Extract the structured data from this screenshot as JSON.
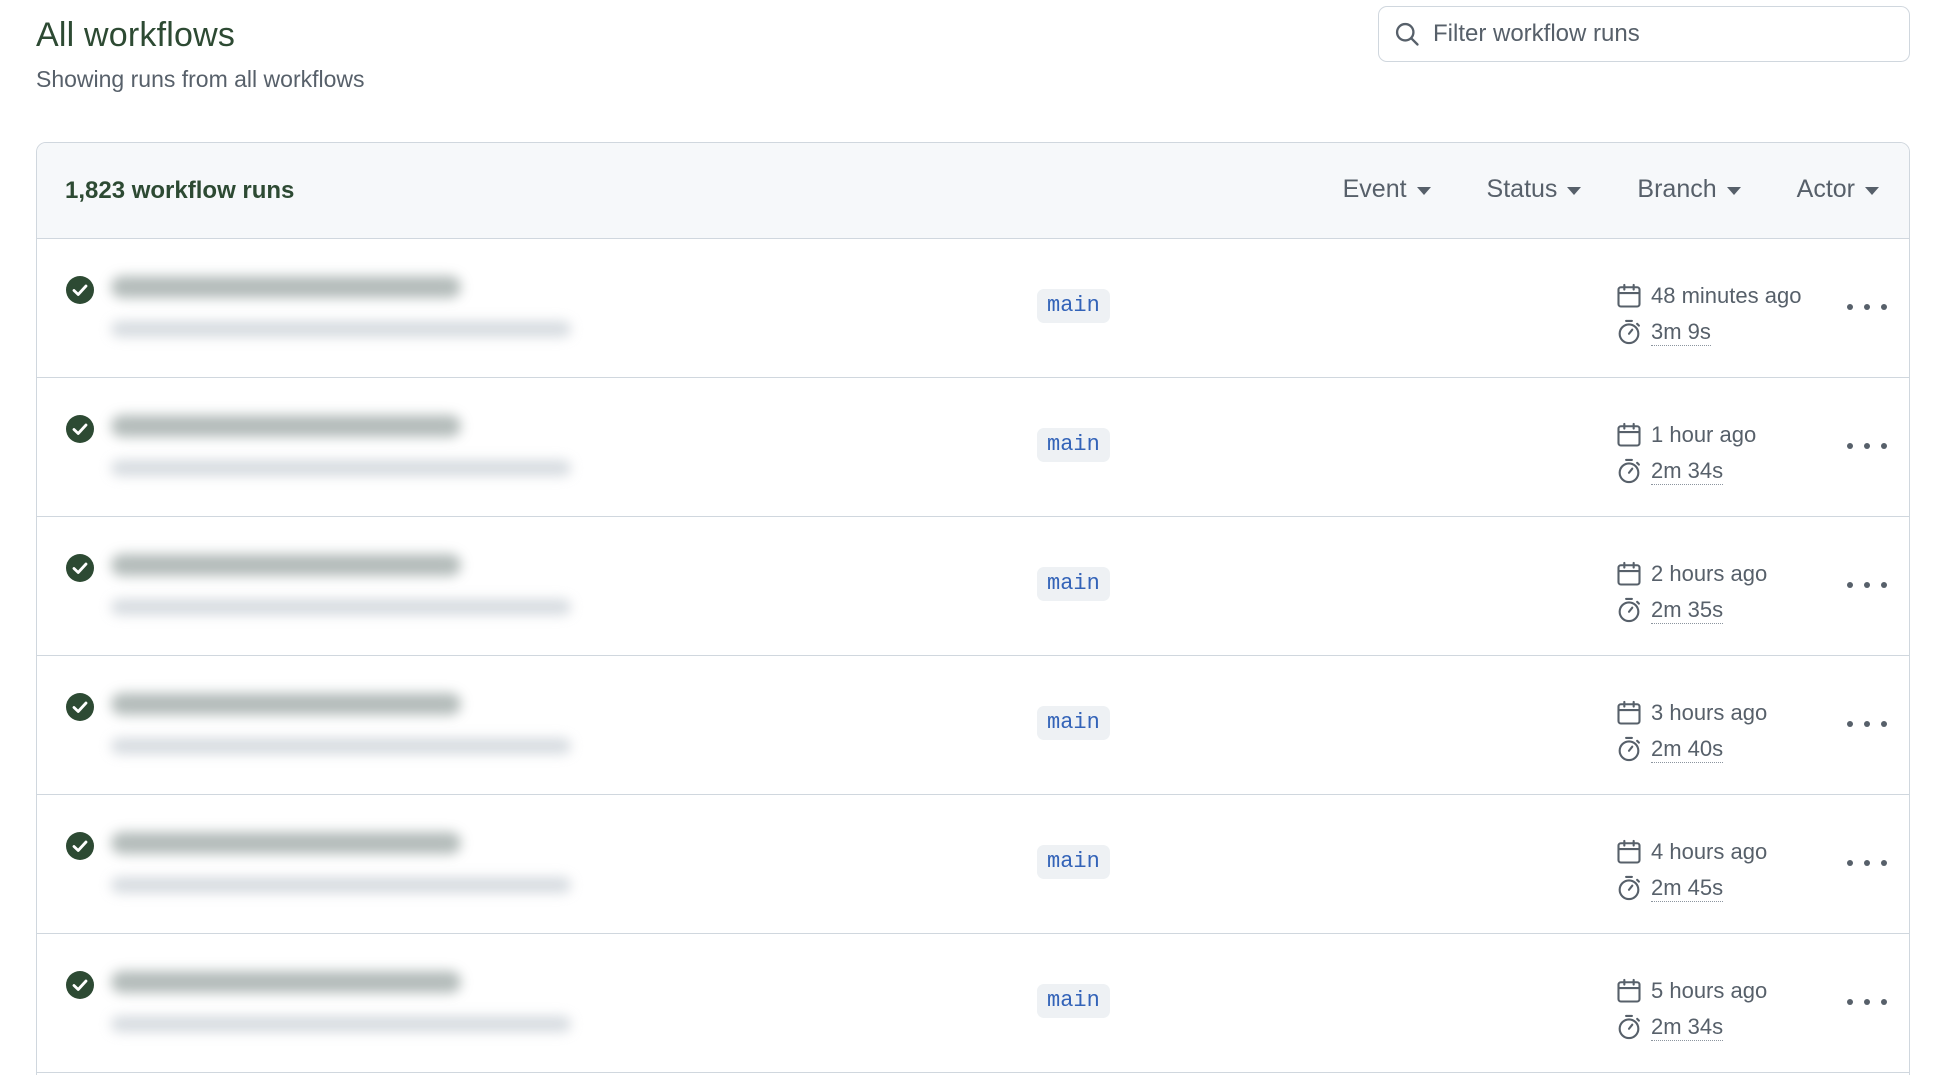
{
  "header": {
    "title": "All workflows",
    "subtitle": "Showing runs from all workflows"
  },
  "search": {
    "placeholder": "Filter workflow runs"
  },
  "runs_box": {
    "count_label": "1,823 workflow runs",
    "filters": [
      {
        "label": "Event"
      },
      {
        "label": "Status"
      },
      {
        "label": "Branch"
      },
      {
        "label": "Actor"
      }
    ]
  },
  "runs": [
    {
      "branch": "main",
      "time_ago": "48 minutes ago",
      "duration": "3m 9s"
    },
    {
      "branch": "main",
      "time_ago": "1 hour ago",
      "duration": "2m 34s"
    },
    {
      "branch": "main",
      "time_ago": "2 hours ago",
      "duration": "2m 35s"
    },
    {
      "branch": "main",
      "time_ago": "3 hours ago",
      "duration": "2m 40s"
    },
    {
      "branch": "main",
      "time_ago": "4 hours ago",
      "duration": "2m 45s"
    },
    {
      "branch": "main",
      "time_ago": "5 hours ago",
      "duration": "2m 34s"
    }
  ],
  "colors": {
    "success": "#2d4a33",
    "branch_text": "#3363b8",
    "branch_bg": "#eef1f4",
    "muted_text": "#57606a",
    "border": "#d0d7de"
  },
  "icons": {
    "search": "search-icon",
    "status": "check-circle-icon",
    "created": "calendar-icon",
    "duration": "stopwatch-icon",
    "menu": "kebab-horizontal-icon",
    "dropdown": "caret-down-icon"
  }
}
